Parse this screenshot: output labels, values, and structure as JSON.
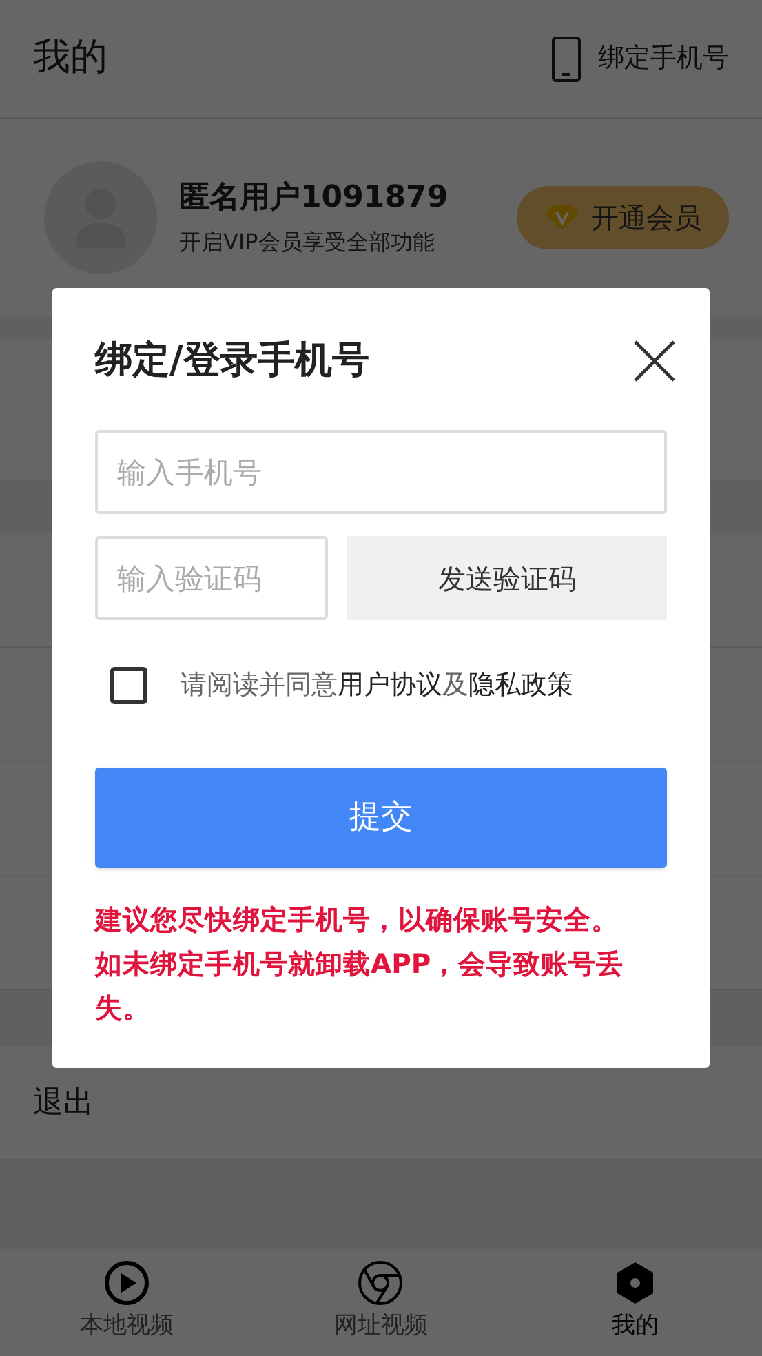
{
  "header": {
    "title": "我的",
    "bind_phone": "绑定手机号"
  },
  "profile": {
    "name": "匿名用户1091879",
    "subtitle": "开启VIP会员享受全部功能",
    "vip_button": "开通会员"
  },
  "logout": "退出",
  "dialog": {
    "title": "绑定/登录手机号",
    "phone": {
      "placeholder": "输入手机号"
    },
    "code": {
      "placeholder": "输入验证码"
    },
    "send_code": "发送验证码",
    "agreement": {
      "checked": false,
      "parts": [
        {
          "kind": "text",
          "text": "请阅读并同意"
        },
        {
          "kind": "link",
          "text": "用户协议"
        },
        {
          "kind": "text",
          "text": "及"
        },
        {
          "kind": "link",
          "text": "隐私政策"
        }
      ]
    },
    "submit": "提交",
    "warning": "建议您尽快绑定手机号，以确保账号安全。如未绑定手机号就卸载APP，会导致账号丢失。"
  },
  "bottom_nav": [
    {
      "label": "本地视频",
      "kind": "play",
      "selected": false
    },
    {
      "label": "网址视频",
      "kind": "browser",
      "selected": false
    },
    {
      "label": "我的",
      "kind": "hexagon",
      "selected": true
    }
  ]
}
